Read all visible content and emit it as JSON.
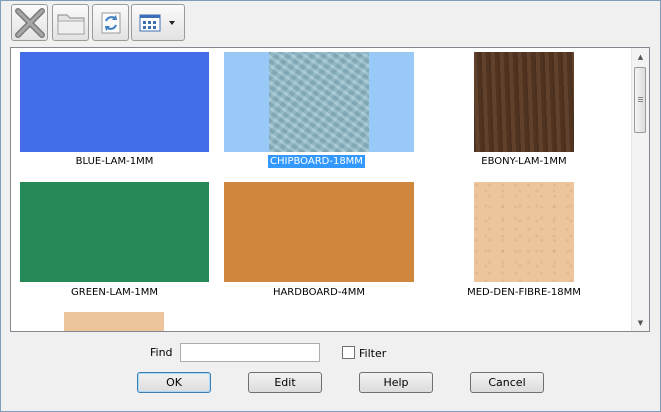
{
  "toolbar": {
    "buttons": [
      {
        "name": "delete-button",
        "icon": "delete-x-icon"
      },
      {
        "name": "open-folder-button",
        "icon": "folder-icon"
      },
      {
        "name": "refresh-button",
        "icon": "refresh-icon"
      },
      {
        "name": "view-mode-button",
        "icon": "grid-view-icon",
        "dropdown": true
      }
    ]
  },
  "materials": [
    {
      "label": "BLUE-LAM-1MM",
      "color": "#436de8",
      "selected": false
    },
    {
      "label": "CHIPBOARD-18MM",
      "color": "#8bb7c7",
      "selected": true
    },
    {
      "label": "EBONY-LAM-1MM",
      "color": "#5a3a24",
      "selected": false
    },
    {
      "label": "GREEN-LAM-1MM",
      "color": "#268958",
      "selected": false
    },
    {
      "label": "HARDBOARD-4MM",
      "color": "#cf873d",
      "selected": false
    },
    {
      "label": "MED-DEN-FIBRE-18MM",
      "color": "#eec49a",
      "selected": false
    },
    {
      "label": "",
      "color": "#eec49a",
      "selected": false
    }
  ],
  "selection_color": "#99c9f7",
  "find": {
    "label": "Find",
    "value": ""
  },
  "filter": {
    "label": "Filter",
    "checked": false
  },
  "buttons": {
    "ok": "OK",
    "edit": "Edit",
    "help": "Help",
    "cancel": "Cancel"
  }
}
